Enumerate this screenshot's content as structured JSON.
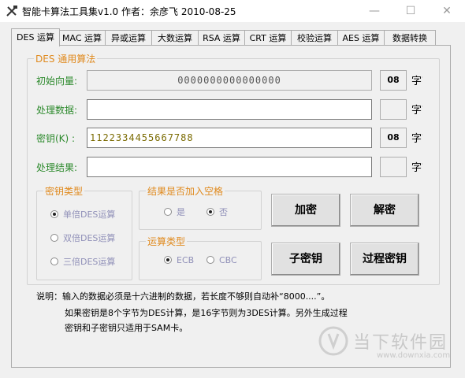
{
  "window": {
    "title": "智能卡算法工具集v1.0  作者：余彦飞 2010-08-25",
    "minimize": "—",
    "maximize": "☐",
    "close": "✕"
  },
  "tabs": [
    "DES 运算",
    "MAC 运算",
    "异或运算",
    "大数运算",
    "RSA 运算",
    "CRT 运算",
    "校验运算",
    "AES 运算",
    "数据转换"
  ],
  "des": {
    "group_title": "DES 通用算法",
    "iv": {
      "label": "初始向量:",
      "value": "0000000000000000",
      "length": "08"
    },
    "data": {
      "label": "处理数据:",
      "value": "",
      "length": ""
    },
    "key": {
      "label": "密钥(K) :",
      "value": "1122334455667788",
      "length": "08"
    },
    "result": {
      "label": "处理结果:",
      "value": "",
      "length": ""
    },
    "unit": "字节"
  },
  "key_type": {
    "title": "密钥类型",
    "options": [
      "单倍DES运算",
      "双倍DES运算",
      "三倍DES运算"
    ],
    "selected": 0
  },
  "space_option": {
    "title": "结果是否加入空格",
    "options": [
      "是",
      "否"
    ],
    "selected": 1
  },
  "algo_type": {
    "title": "运算类型",
    "options": [
      "ECB",
      "CBC"
    ],
    "selected": 0
  },
  "buttons": {
    "encrypt": "加密",
    "decrypt": "解密",
    "subkey": "子密钥",
    "process_key": "过程密钥"
  },
  "notes": {
    "line1": "说明：输入的数据必须是十六进制的数据，若长度不够则自动补“8000....”。",
    "line2": "如果密钥是8个字节为DES计算，是16字节则为3DES计算。另外生成过程",
    "line3": "密钥和子密钥只适用于SAM卡。"
  },
  "watermark": {
    "name": "当下软件园",
    "url": "www.downxia.com"
  }
}
